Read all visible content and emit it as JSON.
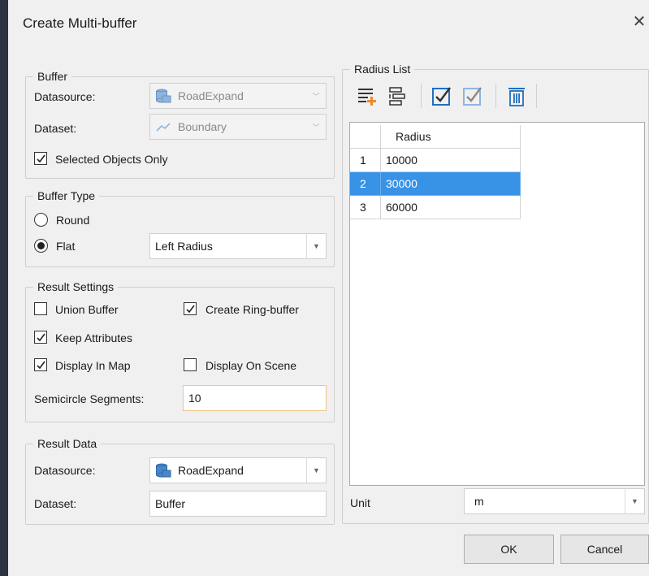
{
  "dialog": {
    "title": "Create Multi-buffer"
  },
  "buffer": {
    "legend": "Buffer",
    "datasource_label": "Datasource:",
    "datasource_value": "RoadExpand",
    "dataset_label": "Dataset:",
    "dataset_value": "Boundary",
    "selected_only_label": "Selected Objects Only",
    "selected_only_checked": true
  },
  "buffer_type": {
    "legend": "Buffer Type",
    "round_label": "Round",
    "flat_label": "Flat",
    "selected": "Flat",
    "flat_option": "Left Radius"
  },
  "result_settings": {
    "legend": "Result Settings",
    "union_label": "Union Buffer",
    "union_checked": false,
    "ring_label": "Create Ring-buffer",
    "ring_checked": true,
    "keep_attr_label": "Keep Attributes",
    "keep_attr_checked": true,
    "display_map_label": "Display In Map",
    "display_map_checked": true,
    "display_scene_label": "Display On Scene",
    "display_scene_checked": false,
    "segments_label": "Semicircle Segments:",
    "segments_value": "10"
  },
  "result_data": {
    "legend": "Result Data",
    "datasource_label": "Datasource:",
    "datasource_value": "RoadExpand",
    "dataset_label": "Dataset:",
    "dataset_value": "Buffer"
  },
  "radius_list": {
    "legend": "Radius List",
    "column_header": "Radius",
    "rows": [
      {
        "index": "1",
        "radius": "10000"
      },
      {
        "index": "2",
        "radius": "30000"
      },
      {
        "index": "3",
        "radius": "60000"
      }
    ],
    "selected_row": 2,
    "toolbar_icons": [
      "add-row-icon",
      "insert-row-icon",
      "select-all-icon",
      "invert-select-icon",
      "delete-icon"
    ]
  },
  "unit": {
    "label": "Unit",
    "value": "m"
  },
  "buttons": {
    "ok": "OK",
    "cancel": "Cancel"
  },
  "colors": {
    "selection": "#3892e6",
    "focus_border": "#f1c48b",
    "accent_orange": "#f08a24",
    "icon_blue": "#1f6fc2"
  }
}
